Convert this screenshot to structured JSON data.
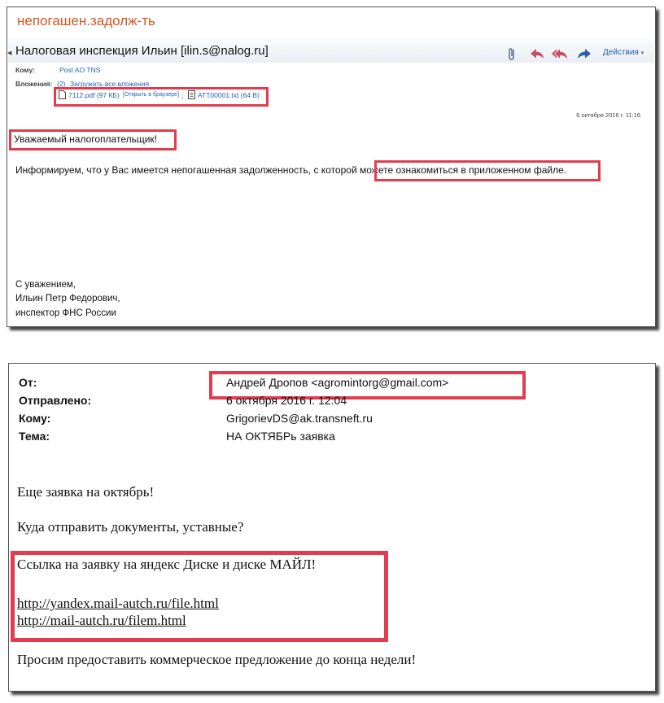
{
  "email1": {
    "subject": "непогашен.задолж-ть",
    "sender": "Налоговая инспекция Ильин [ilin.s@nalog.ru]",
    "actions_label": "Действия",
    "to_label": "Кому:",
    "to_value": "Post AO TNS",
    "attachments_label": "Вложения:",
    "attachments_count": "(2)",
    "download_all": "Загружать все вложения",
    "attachment1": "7112.pdf (97 КБ)",
    "open_in_browser": "[Открыть в браузере]",
    "separator": ";",
    "attachment2": "ATT00001.txt (64 B)",
    "date": "6 октября 2016 г. 11:16",
    "greeting": "Уважаемый налогоплательщик!",
    "body_start": "Информируем, что у Вас имеется непогашенная задолженность, с которой ",
    "body_highlight": "можете ознакомиться в приложенном файле.",
    "signature": [
      "С уважением,",
      "Ильин Петр Федорович,",
      "инспектор ФНС России"
    ],
    "colors": {
      "subject": "#d4561e",
      "accent": "#2563b6",
      "highlight_box": "#e23d4e"
    },
    "icons": [
      "paperclip-icon",
      "reply-icon",
      "reply-all-icon",
      "forward-icon",
      "chevron-down-icon",
      "document-icon",
      "text-file-icon"
    ]
  },
  "email2": {
    "from_label": "От:",
    "from_value": "Андрей Дропов <agromintorg@gmail.com>",
    "sent_label": "Отправлено:",
    "sent_value": "6 октября 2016 г. 12:04",
    "to_label": "Кому:",
    "to_value": "GrigorievDS@ak.transneft.ru",
    "subject_label": "Тема:",
    "subject_value": "НА ОКТЯБРь заявка",
    "line1": "Еще  заявка на октябрь!",
    "line2": "Куда отправить документы, уставные?",
    "line3": "Ссылка на заявку на яндекс Диске и диске МАЙЛ!",
    "link1": "http://yandex.mail-autch.ru/file.html",
    "link2": "http://mail-autch.ru/filem.html",
    "line4": "Просим предоставить коммерческое предложение до конца недели!"
  }
}
